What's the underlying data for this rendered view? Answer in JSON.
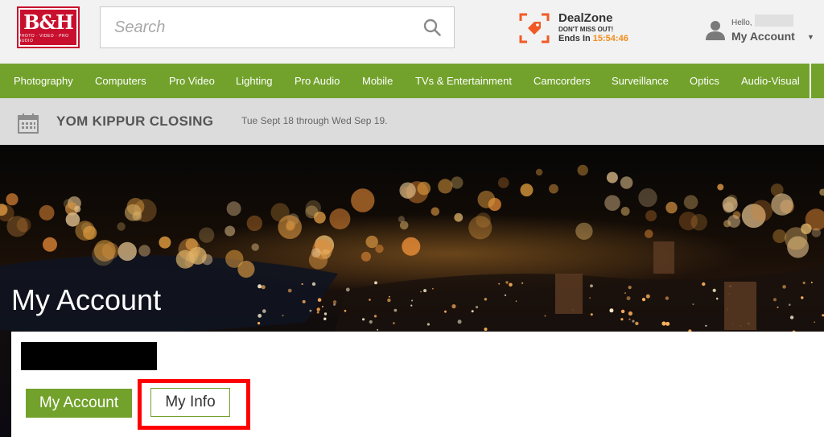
{
  "brand": {
    "logo_text": "B&H",
    "logo_sub": "PHOTO · VIDEO · PRO AUDIO"
  },
  "search": {
    "placeholder": "Search",
    "value": ""
  },
  "dealzone": {
    "title": "DealZone",
    "subtitle": "DON'T MISS OUT!",
    "ends_label": "Ends In ",
    "timer": "15:54:46",
    "accent": "#f28c1a"
  },
  "account": {
    "hello": "Hello,",
    "label": "My Account",
    "caret": "▼"
  },
  "nav": {
    "color": "#72a22c",
    "items": [
      "Photography",
      "Computers",
      "Pro Video",
      "Lighting",
      "Pro Audio",
      "Mobile",
      "TVs & Entertainment",
      "Camcorders",
      "Surveillance",
      "Optics",
      "Audio-Visual"
    ]
  },
  "announcement": {
    "title": "YOM KIPPUR CLOSING",
    "text": "Tue Sept 18 through Wed Sep 19."
  },
  "hero": {
    "title": "My Account"
  },
  "account_card": {
    "my_account_button": "My Account",
    "my_info_button": "My Info",
    "highlight_color": "#ff0000"
  }
}
